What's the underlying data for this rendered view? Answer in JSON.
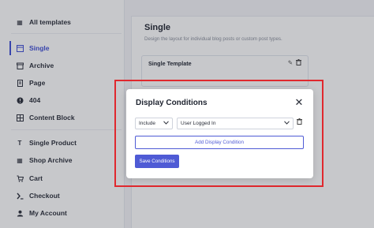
{
  "sidebar": {
    "items": [
      {
        "label": "All templates",
        "icon": "grid-icon",
        "active": false
      },
      {
        "label": "Single",
        "icon": "layout-icon",
        "active": true
      },
      {
        "label": "Archive",
        "icon": "archive-icon",
        "active": false
      },
      {
        "label": "Page",
        "icon": "page-icon",
        "active": false
      },
      {
        "label": "404",
        "icon": "alert-icon",
        "active": false
      },
      {
        "label": "Content Block",
        "icon": "block-icon",
        "active": false
      },
      {
        "label": "Single Product",
        "icon": "text-icon",
        "active": false
      },
      {
        "label": "Shop Archive",
        "icon": "grid-icon",
        "active": false
      },
      {
        "label": "Cart",
        "icon": "cart-icon",
        "active": false
      },
      {
        "label": "Checkout",
        "icon": "checkout-icon",
        "active": false
      },
      {
        "label": "My Account",
        "icon": "user-icon",
        "active": false
      }
    ]
  },
  "main": {
    "title": "Single",
    "description": "Design the layout for individual blog posts or custom post types.",
    "template_card": {
      "title": "Single Template"
    }
  },
  "modal": {
    "title": "Display Conditions",
    "include_select": {
      "value": "Include"
    },
    "condition_select": {
      "value": "User Logged In"
    },
    "add_condition_label": "Add Display Condition",
    "save_label": "Save Conditions"
  },
  "colors": {
    "accent": "#4f5bd5",
    "highlight": "#e0282e"
  }
}
